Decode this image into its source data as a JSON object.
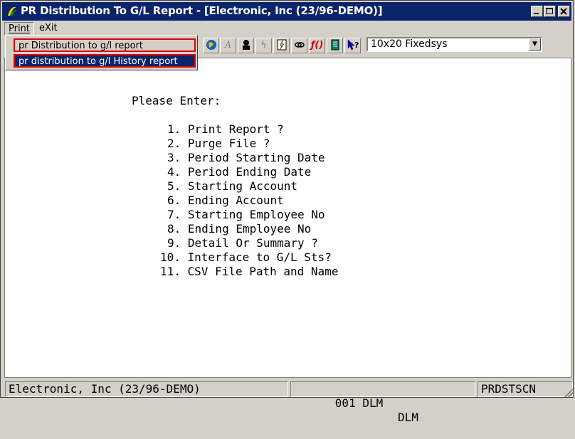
{
  "window": {
    "title": "PR Distribution To G/L Report - [Electronic, Inc (23/96-DEMO)]"
  },
  "menubar": {
    "items": [
      {
        "label": "Print",
        "accel": "P"
      },
      {
        "label": "eXit",
        "accel": "X"
      }
    ]
  },
  "print_menu": {
    "items": [
      {
        "label": "pr Distribution to g/l report",
        "selected": false
      },
      {
        "label": "pr distribution to g/l History report",
        "selected": true
      }
    ]
  },
  "toolbar": {
    "icons": [
      "globe-icon",
      "font-icon",
      "bust-icon",
      "lightning-icon",
      "lightning-doc-icon",
      "link-icon",
      "function-icon",
      "notes-icon",
      "help-pointer-icon"
    ],
    "font_select": {
      "value": "10x20 Fixedsys"
    }
  },
  "screen": {
    "prompt": "Please Enter:",
    "items": [
      "1. Print Report ?",
      "2. Purge File ?",
      "3. Period Starting Date",
      "4. Period Ending Date",
      "5. Starting Account",
      "6. Ending Account",
      "7. Starting Employee No",
      "8. Ending Employee No",
      "9. Detail Or Summary ?",
      "10. Interface to G/L Sts?",
      "11. CSV File Path and Name"
    ]
  },
  "status": {
    "company": "Electronic, Inc (23/96-DEMO)",
    "code": "001 DLM",
    "user": "DLM",
    "program": "PRDSTSCN"
  },
  "colors": {
    "titlebar": "#0a246a",
    "highlight": "#0a246a",
    "dropdown_outline": "#e00000",
    "chrome": "#d4d0c8"
  }
}
